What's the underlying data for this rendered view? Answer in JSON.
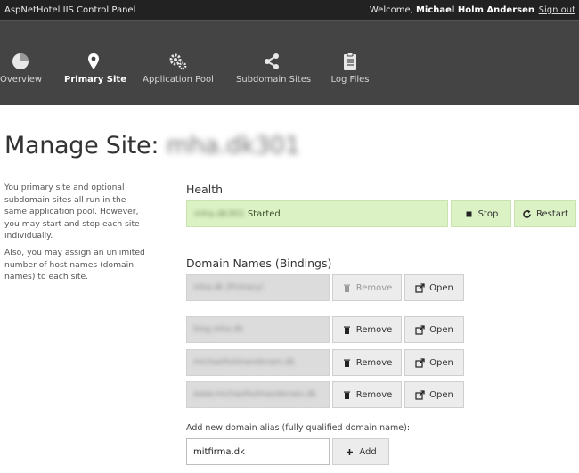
{
  "topbar": {
    "app_title": "AspNetHotel IIS Control Panel",
    "welcome_prefix": "Welcome,",
    "user_name": "Michael Holm Andersen",
    "signout": "Sign out"
  },
  "nav": {
    "items": [
      {
        "label": "Overview",
        "icon": "pie-chart-icon",
        "active": false
      },
      {
        "label": "Primary Site",
        "icon": "map-pin-icon",
        "active": true
      },
      {
        "label": "Application Pool",
        "icon": "gears-icon",
        "active": false
      },
      {
        "label": "Subdomain Sites",
        "icon": "share-icon",
        "active": false
      },
      {
        "label": "Log Files",
        "icon": "clipboard-icon",
        "active": false
      }
    ]
  },
  "page": {
    "title": "Manage Site:",
    "site_name": "mha.dk301"
  },
  "help": {
    "p1": "You primary site and optional subdomain sites all run in the same application pool. However, you may start and stop each site individually.",
    "p2": "Also, you may assign an unlimited number of host names (domain names) to each site."
  },
  "health": {
    "heading": "Health",
    "site_name": "mha.dk301",
    "status": "Started",
    "stop_label": "Stop",
    "restart_label": "Restart",
    "colors": {
      "ok_background": "#dbf2c5"
    }
  },
  "domains": {
    "heading": "Domain Names (Bindings)",
    "remove_label": "Remove",
    "open_label": "Open",
    "items": [
      {
        "name": "mha.dk (Primary)",
        "removable": false
      },
      {
        "name": "blog.mha.dk",
        "removable": true
      },
      {
        "name": "michaelholmandersen.dk",
        "removable": true
      },
      {
        "name": "www.michaelholmandersen.dk",
        "removable": true
      }
    ]
  },
  "new_alias": {
    "label": "Add new domain alias (fully qualified domain name):",
    "value": "mitfirma.dk",
    "add_label": "Add"
  }
}
